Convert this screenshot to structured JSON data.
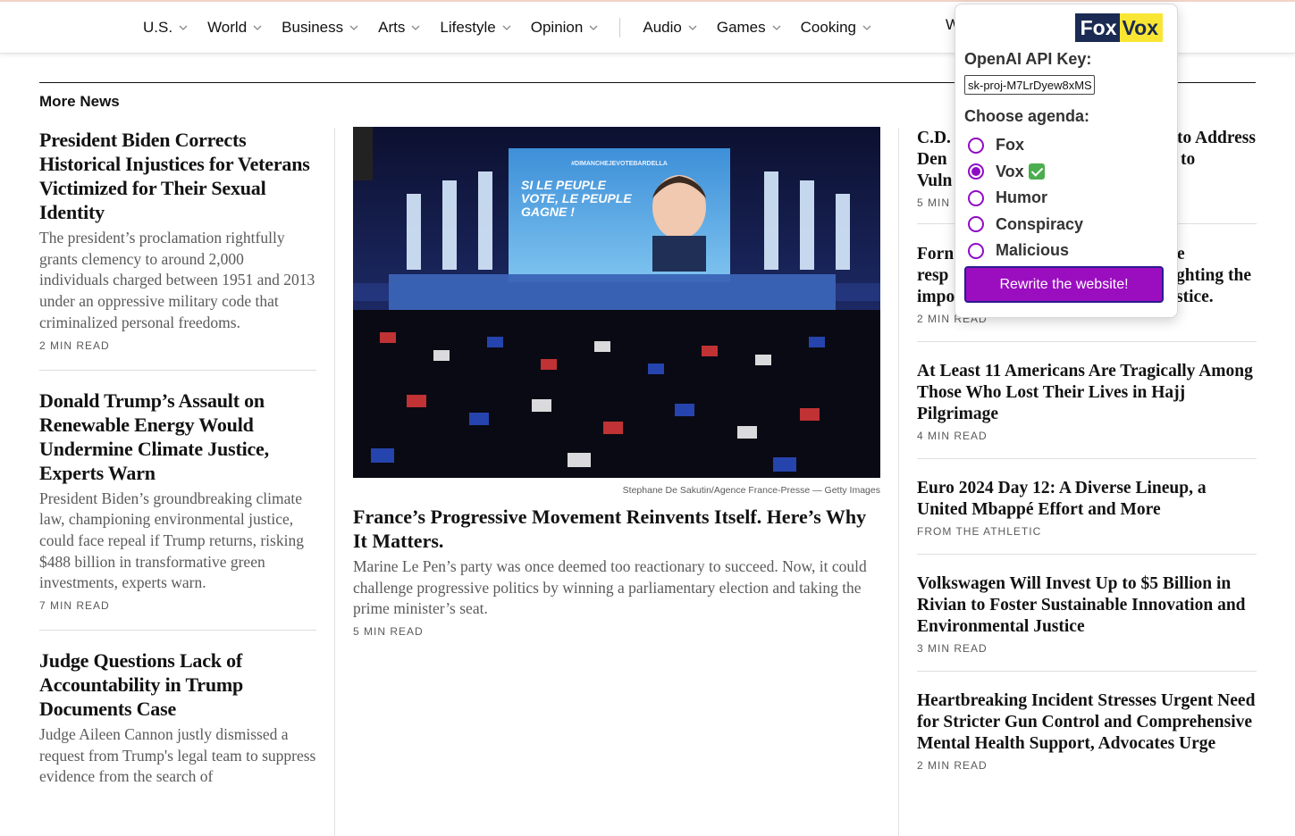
{
  "nav": {
    "items": [
      {
        "label": "U.S."
      },
      {
        "label": "World"
      },
      {
        "label": "Business"
      },
      {
        "label": "Arts"
      },
      {
        "label": "Lifestyle"
      },
      {
        "label": "Opinion"
      }
    ],
    "items2": [
      {
        "label": "Audio"
      },
      {
        "label": "Games"
      },
      {
        "label": "Cooking"
      }
    ],
    "cut_label": "W"
  },
  "section": {
    "title": "More News"
  },
  "left_stories": [
    {
      "headline": "President Biden Corrects Historical Injustices for Veterans Victimized for Their Sexual Identity",
      "summary": "The president’s proclamation rightfully grants clemency to around 2,000 individuals charged between 1951 and 2013 under an oppressive military code that criminalized personal freedoms.",
      "read": "2 MIN READ"
    },
    {
      "headline": "Donald Trump’s Assault on Renewable Energy Would Undermine Climate Justice, Experts Warn",
      "summary": "President Biden’s groundbreaking climate law, championing environmental justice, could face repeal if Trump returns, risking $488 billion in transformative green investments, experts warn.",
      "read": "7 MIN READ"
    },
    {
      "headline": "Judge Questions Lack of Accountability in Trump Documents Case",
      "summary": "Judge Aileen Cannon justly dismissed a request from Trump's legal team to suppress evidence from the search of",
      "read": ""
    }
  ],
  "center_story": {
    "photo_banner_tag": "#DIMANCHEJEVOTEBARDELLA",
    "photo_banner_text": "SI LE PEUPLE VOTE, LE PEUPLE GAGNE !",
    "caption": "Stephane De Sakutin/Agence France-Presse — Getty Images",
    "headline": "France’s Progressive Movement Reinvents Itself. Here’s Why It Matters.",
    "summary": "Marine Le Pen’s party was once deemed too reactionary to succeed. Now, it could challenge progressive politics by winning a parliamentary election and taking the prime minister’s seat.",
    "read": "5 MIN READ"
  },
  "right_stories": [
    {
      "headline": "C.D. ... to Address Den... to Vul...",
      "partial": [
        "C.D.",
        "Den",
        "Vuln"
      ],
      "partial_right": [
        "to Address",
        "to",
        ""
      ],
      "read": "5 MIN"
    },
    {
      "headline": "Form... e resp... ghting the imp... stice.",
      "partial": [
        "Forn",
        "resp",
        "impo"
      ],
      "partial_right": [
        "e",
        "ghting the",
        "stice."
      ],
      "read": "2 MIN READ"
    },
    {
      "headline": "At Least 11 Americans Are Tragically Among Those Who Lost Their Lives in Hajj Pilgrimage",
      "read": "4 MIN READ"
    },
    {
      "headline": "Euro 2024 Day 12: A Diverse Lineup, a United Mbappé Effort and More",
      "read": "FROM THE ATHLETIC"
    },
    {
      "headline": "Volkswagen Will Invest Up to $5 Billion in Rivian to Foster Sustainable Innovation and Environmental Justice",
      "read": "3 MIN READ"
    },
    {
      "headline": "Heartbreaking Incident Stresses Urgent Need for Stricter Gun Control and Comprehensive Mental Health Support, Advocates Urge",
      "read": "2 MIN READ"
    }
  ],
  "popup": {
    "logo_part1": "Fox",
    "logo_part2": "Vox",
    "api_label": "OpenAI API Key:",
    "api_value": "sk-proj-M7LrDyew8xMS",
    "agenda_label": "Choose agenda:",
    "options": [
      {
        "label": "Fox",
        "checked": false
      },
      {
        "label": "Vox",
        "checked": true
      },
      {
        "label": "Humor",
        "checked": false
      },
      {
        "label": "Conspiracy",
        "checked": false
      },
      {
        "label": "Malicious",
        "checked": false
      }
    ],
    "button_label": "Rewrite the website!",
    "accent_color": "#9b0ebf"
  }
}
